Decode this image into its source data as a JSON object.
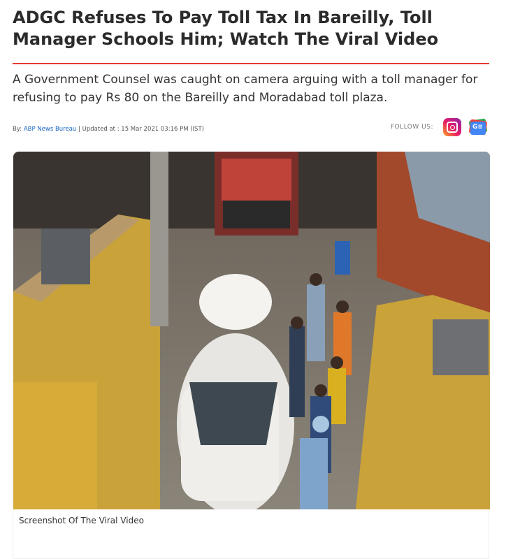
{
  "article": {
    "headline": "ADGC Refuses To Pay Toll Tax In Bareilly, Toll Manager Schools Him; Watch The Viral Video",
    "summary": "A Government Counsel was caught on camera arguing with a toll manager for refusing to pay Rs 80 on the Bareilly and Moradabad toll plaza.",
    "byline_prefix": "By:",
    "author": "ABP News Bureau",
    "separator": "|",
    "updated": "Updated at : 15 Mar 2021 03:16 PM (IST)"
  },
  "follow": {
    "label": "FOLLOW US:",
    "icons": [
      "instagram-icon",
      "google-news-icon"
    ],
    "google_news_glyph": "G≡"
  },
  "media": {
    "caption": "Screenshot Of The Viral Video"
  },
  "colors": {
    "accent_rule": "#e53935",
    "link": "#1565c0"
  }
}
